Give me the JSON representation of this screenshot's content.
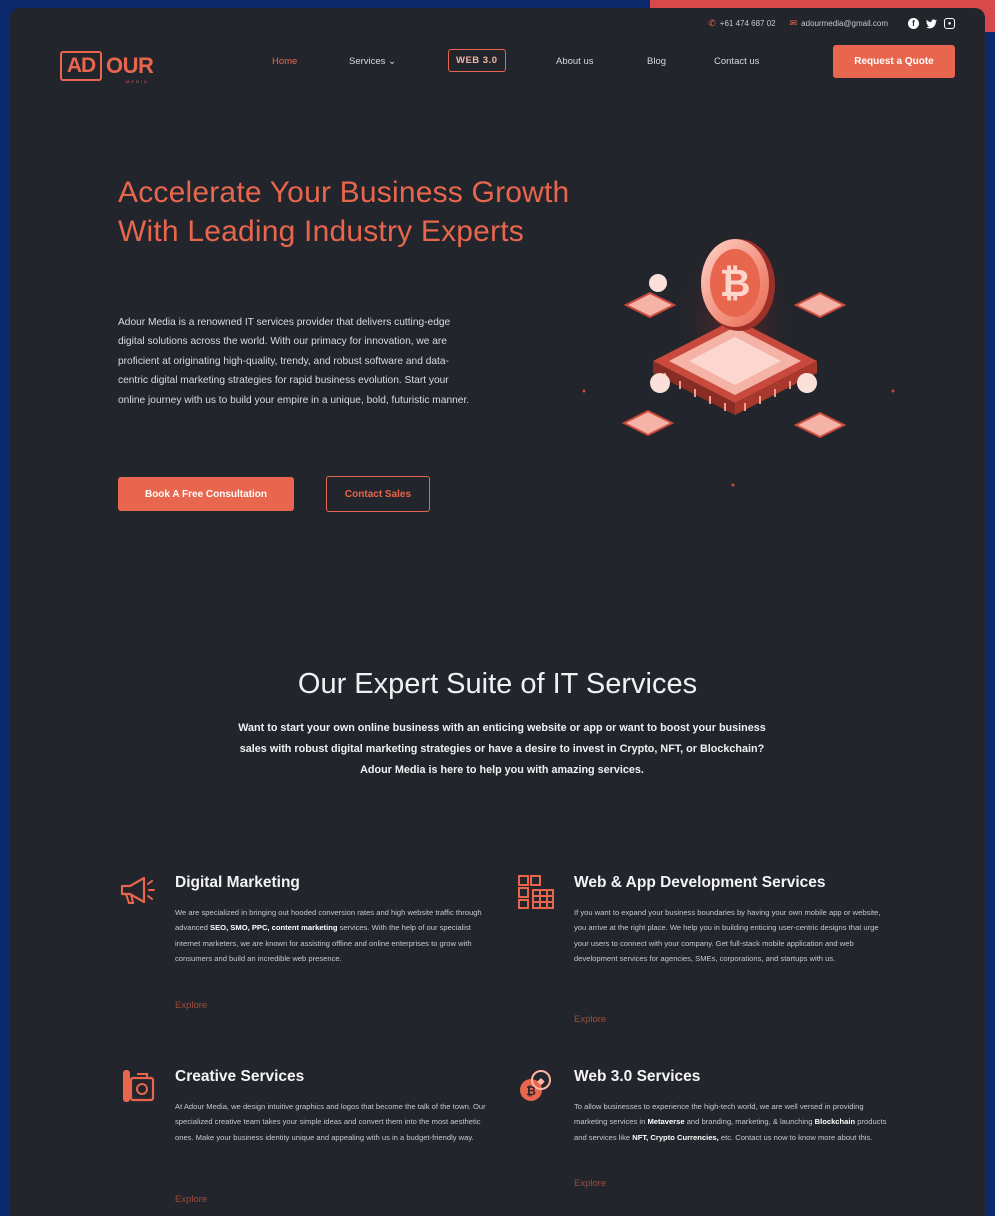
{
  "topbar": {
    "phone": "+61 474 687 02",
    "email": "adourmedia@gmail.com",
    "social": [
      "facebook-icon",
      "twitter-icon",
      "instagram-icon"
    ]
  },
  "logo": {
    "part1": "AD",
    "part2": "OUR",
    "tagline": "MEDIA"
  },
  "nav": {
    "home": "Home",
    "services": "Services ⌄",
    "web3": "WEB 3.0",
    "about": "About us",
    "blog": "Blog",
    "contact": "Contact us",
    "cta": "Request a Quote"
  },
  "hero": {
    "title": "Accelerate Your Business Growth With Leading Industry Experts",
    "text": "Adour Media is a renowned IT services provider that delivers cutting-edge digital solutions across the world. With our primacy for innovation, we are proficient at originating high-quality, trendy, and robust software and data-centric digital marketing strategies for rapid business evolution. Start your online journey with us to build your empire in a unique, bold, futuristic manner.",
    "primary_button": "Book A Free Consultation",
    "secondary_button": "Contact Sales"
  },
  "services": {
    "title": "Our Expert Suite of IT Services",
    "intro": "Want to start your own online business with an enticing website or app or want to boost your business sales with robust digital marketing strategies or have a desire to invest in Crypto, NFT, or Blockchain? Adour Media is here to help you with amazing services.",
    "explore_label": "Explore",
    "cards": [
      {
        "title": "Digital Marketing",
        "icon": "megaphone-icon",
        "text_a": "We are specialized in bringing out hooded conversion rates and high website traffic through advanced ",
        "bold_a": "SEO, SMO, PPC, content marketing",
        "text_b": " services. With the help of our specialist internet marketers, we are known for assisting offline and online enterprises to grow with consumers and build an incredible web presence."
      },
      {
        "title": "Web & App Development Services",
        "icon": "app-grid-icon",
        "text_a": "If you want to expand your business boundaries by having your own mobile app or website, you arrive at the right place. We help you in building enticing user-centric designs that urge your users to connect with your company. Get full-stack mobile application and web development services for agencies, SMEs, corporations, and startups with us.",
        "bold_a": "",
        "text_b": ""
      },
      {
        "title": "Creative Services",
        "icon": "creative-design-icon",
        "text_a": "At Adour Media, we design intuitive graphics and logos that become the talk of the town. Our specialized creative team takes your simple ideas and convert them into the most aesthetic ones. Make your business identity unique and appealing with us in a budget-friendly way.",
        "bold_a": "",
        "text_b": ""
      },
      {
        "title": "Web 3.0 Services",
        "icon": "crypto-coins-icon",
        "text_a": "To allow businesses to experience the high-tech world, we are well versed in providing marketing services in ",
        "bold_a": "Metaverse",
        "text_b": " and branding, marketing, & launching ",
        "bold_b": "Blockchain",
        "text_c": " products and services like ",
        "bold_c": "NFT, Crypto Currencies,",
        "text_d": " etc. Contact us now to know more about this."
      }
    ]
  },
  "colors": {
    "accent": "#e8664d",
    "page_bg": "#22252b",
    "frame_bg": "#0c2a6b",
    "corner": "#d8494c"
  }
}
